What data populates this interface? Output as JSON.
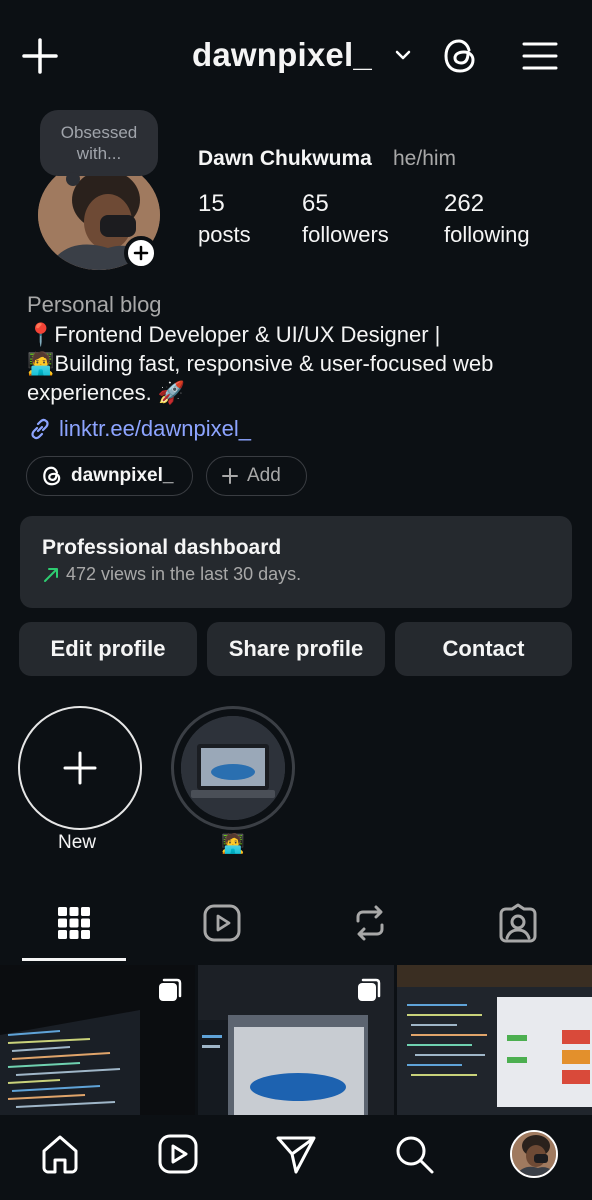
{
  "header": {
    "username": "dawnpixel_",
    "icons": [
      "plus-icon",
      "chevron-down-icon",
      "threads-icon",
      "menu-icon"
    ]
  },
  "profile": {
    "note": "Obsessed with...",
    "full_name": "Dawn Chukwuma",
    "pronouns": "he/him",
    "stats": {
      "posts": {
        "value": "15",
        "label": "posts"
      },
      "followers": {
        "value": "65",
        "label": "followers"
      },
      "following": {
        "value": "262",
        "label": "following"
      }
    },
    "category": "Personal blog",
    "bio_line1": "📍Frontend Developer & UI/UX Designer |",
    "bio_line2": "🧑‍💻Building fast, responsive & user-focused web",
    "bio_line3": "experiences. 🚀",
    "link": "linktr.ee/dawnpixel_"
  },
  "pills": {
    "threads_handle": "dawnpixel_",
    "add_label": "Add"
  },
  "dashboard": {
    "title": "Professional dashboard",
    "subtitle": "472 views in the last 30 days.",
    "trend_color": "#2ecc71"
  },
  "actions": {
    "edit": "Edit profile",
    "share": "Share profile",
    "contact": "Contact"
  },
  "highlights": [
    {
      "label": "New"
    },
    {
      "label": "🧑‍💻"
    }
  ],
  "tabs": [
    "grid-icon",
    "reels-icon",
    "reposts-icon",
    "tagged-icon"
  ],
  "bottom_nav": [
    "home-icon",
    "reels-icon",
    "send-icon",
    "search-icon",
    "profile-avatar"
  ],
  "colors": {
    "background": "#0c1014",
    "surface": "#25292e",
    "link": "#8da4ff"
  }
}
